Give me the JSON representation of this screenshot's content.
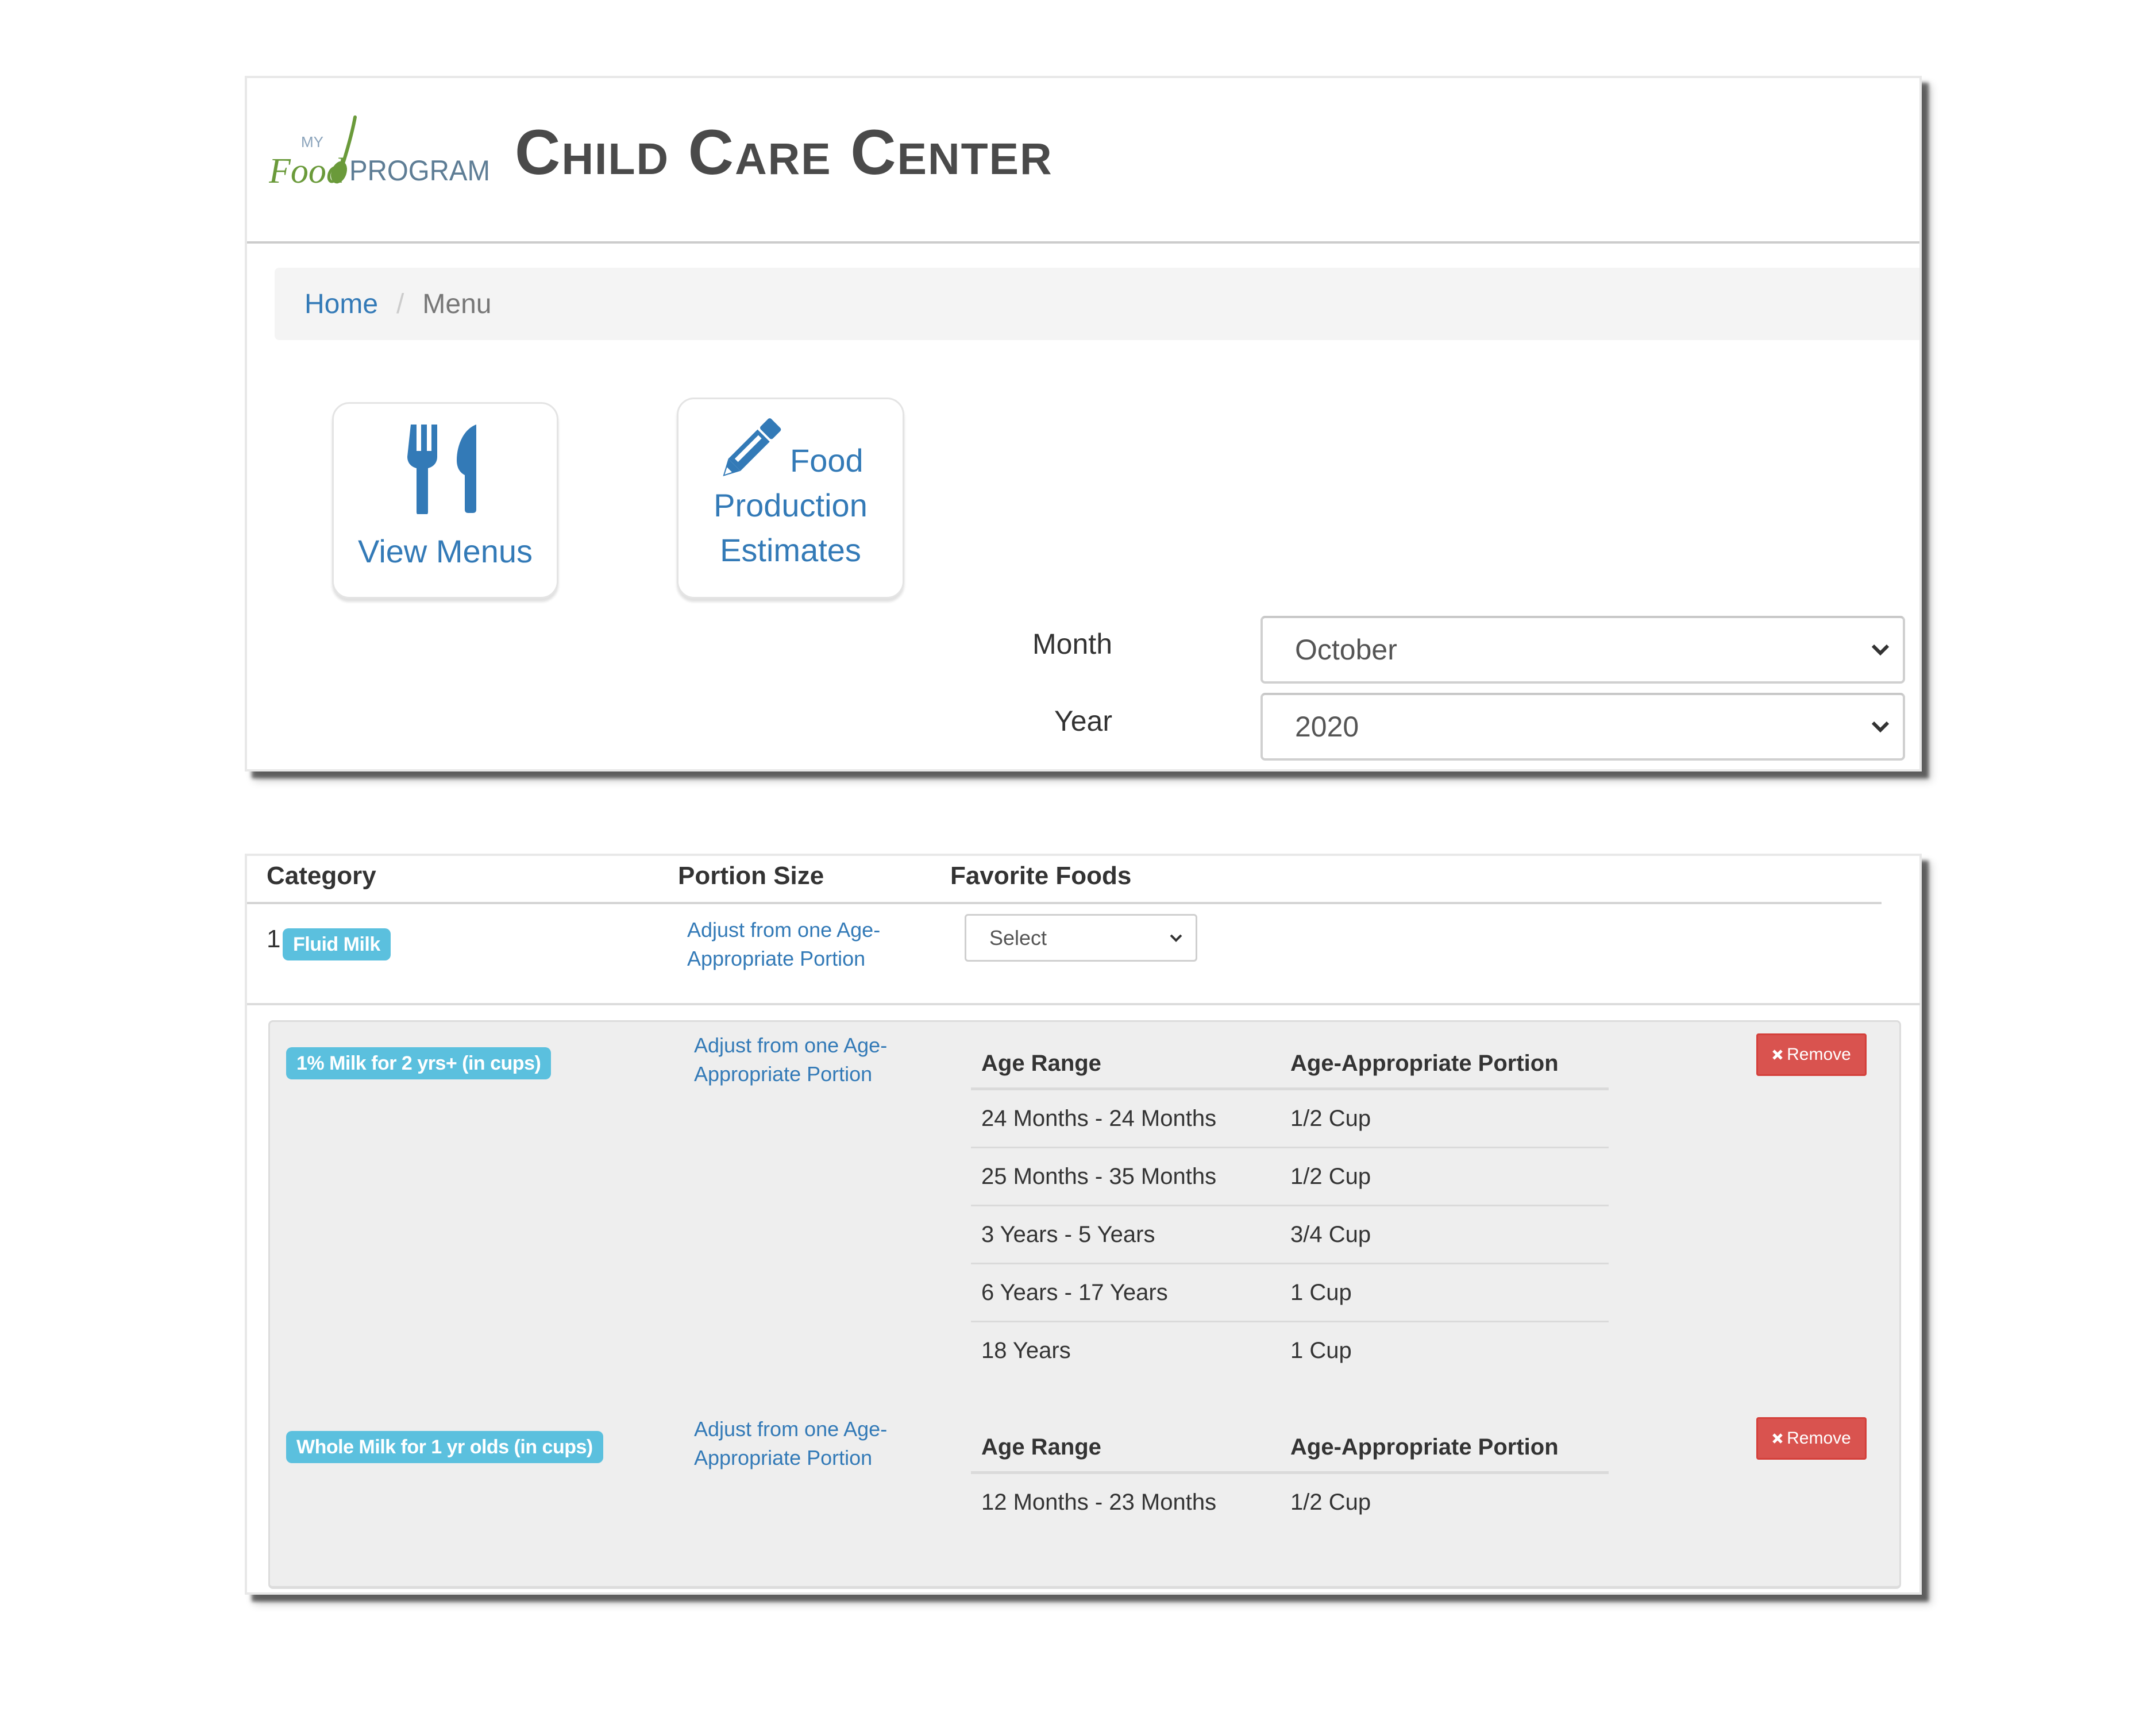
{
  "header": {
    "logo_text": {
      "my": "MY",
      "food": "Food",
      "program": "PROGRAM"
    },
    "title": "Child Care Center"
  },
  "breadcrumb": {
    "home": "Home",
    "separator": "/",
    "current": "Menu"
  },
  "tiles": {
    "view_menus": {
      "label": "View Menus",
      "icon": "cutlery-icon"
    },
    "food_production": {
      "line1": "Food",
      "line2": "Production",
      "line3": "Estimates",
      "icon": "pencil-icon"
    }
  },
  "filters": {
    "month_label": "Month",
    "month_value": "October",
    "year_label": "Year",
    "year_value": "2020"
  },
  "table": {
    "headers": {
      "category": "Category",
      "portion": "Portion Size",
      "favorites": "Favorite Foods"
    },
    "rows": [
      {
        "number": "1",
        "category": "Fluid Milk",
        "portion_link": "Adjust from one Age-Appropriate Portion",
        "favorite_select": "Select"
      }
    ]
  },
  "foods": [
    {
      "name": "1% Milk for 2 yrs+ (in cups)",
      "portion_link": "Adjust from one Age-Appropriate Portion",
      "table_headers": {
        "age": "Age Range",
        "portion": "Age-Appropriate Portion"
      },
      "rows": [
        {
          "age": "24 Months - 24 Months",
          "portion": "1/2 Cup"
        },
        {
          "age": "25 Months - 35 Months",
          "portion": "1/2 Cup"
        },
        {
          "age": "3 Years - 5 Years",
          "portion": "3/4 Cup"
        },
        {
          "age": "6 Years - 17 Years",
          "portion": "1 Cup"
        },
        {
          "age": "18 Years",
          "portion": "1 Cup"
        }
      ],
      "remove_label": "Remove"
    },
    {
      "name": "Whole Milk for 1 yr olds (in cups)",
      "portion_link": "Adjust from one Age-Appropriate Portion",
      "table_headers": {
        "age": "Age Range",
        "portion": "Age-Appropriate Portion"
      },
      "rows": [
        {
          "age": "12 Months - 23 Months",
          "portion": "1/2 Cup"
        }
      ],
      "remove_label": "Remove"
    }
  ],
  "colors": {
    "link": "#337ab7",
    "badge": "#5bc0de",
    "danger": "#d9534f",
    "logo_green": "#6a9a3a",
    "logo_slate": "#5e7d95"
  }
}
